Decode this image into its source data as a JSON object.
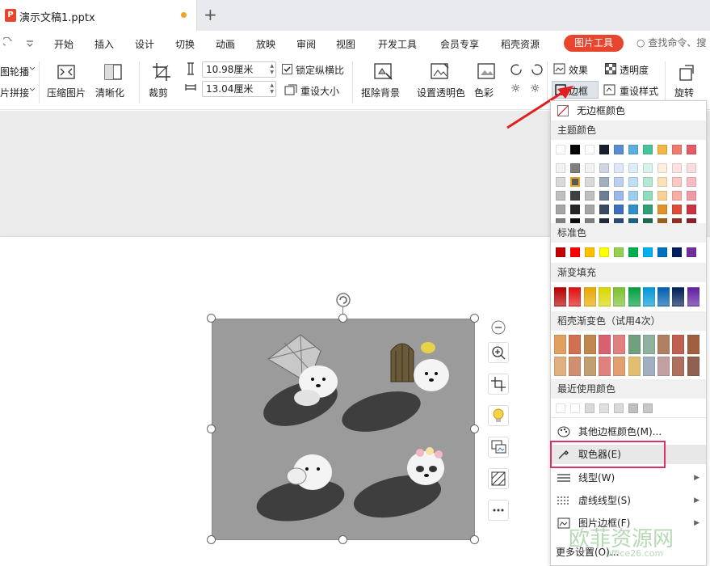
{
  "doc_tab": {
    "logo": "P",
    "title": "演示文稿1.pptx",
    "new_tab": "+"
  },
  "menu": {
    "items": [
      "开始",
      "插入",
      "设计",
      "切换",
      "动画",
      "放映",
      "审阅",
      "视图",
      "开发工具",
      "会员专享",
      "稻壳资源"
    ],
    "picture_tool": "图片工具",
    "search": "查找命令、搜"
  },
  "ribbon": {
    "carousel": "图轮播",
    "stitch": "片拼接",
    "compress": "压缩图片",
    "sharpen": "清晰化",
    "crop": "裁剪",
    "width": "10.98厘米",
    "height": "13.04厘米",
    "lock_ratio": "锁定纵横比",
    "lock_ratio_checked": true,
    "reset_size": "重设大小",
    "remove_bg": "抠除背景",
    "set_transparent": "设置透明色",
    "color": "色彩",
    "effects": "效果",
    "transparency": "透明度",
    "border": "边框",
    "reset_style": "重设样式",
    "rotate": "旋转"
  },
  "dropdown": {
    "no_border": "无边框颜色",
    "theme_title": "主题颜色",
    "theme_top": [
      "#ffffff",
      "#000000",
      "#ffffff",
      "#17202a",
      "#5b8bd0",
      "#5aaee0",
      "#48c39a",
      "#f2b54a",
      "#f07a6b",
      "#e65b68"
    ],
    "theme_shades": [
      [
        "#f2f2f2",
        "#7f7f7f",
        "#f2f2f2",
        "#d0d6e0",
        "#dde7f6",
        "#ddeef9",
        "#d9f3ea",
        "#fdf0db",
        "#fde4e1",
        "#fadde1"
      ],
      [
        "#d9d9d9",
        "#595959",
        "#d9d9d9",
        "#a3aebf",
        "#bdd0ee",
        "#bddff4",
        "#b5e7d5",
        "#fbe1b8",
        "#fac9c3",
        "#f5bcc3"
      ],
      [
        "#bfbfbf",
        "#404040",
        "#bfbfbf",
        "#6d7d95",
        "#9bb8e6",
        "#9ccfee",
        "#90dbc0",
        "#f8d294",
        "#f7ada4",
        "#f09aa5"
      ],
      [
        "#a6a6a6",
        "#262626",
        "#a6a6a6",
        "#3a4a60",
        "#3f6fb9",
        "#2f8fc8",
        "#2f9f77",
        "#e0932a",
        "#e04b39",
        "#cc3345"
      ],
      [
        "#7f7f7f",
        "#0d0d0d",
        "#7f7f7f",
        "#212c3a",
        "#2a4a7c",
        "#1f6086",
        "#1f6a4f",
        "#9a6219",
        "#952f22",
        "#88202e"
      ]
    ],
    "standard_title": "标准色",
    "standard": [
      "#c00000",
      "#ff0000",
      "#ffc000",
      "#ffff00",
      "#92d050",
      "#00b050",
      "#00b0f0",
      "#0070c0",
      "#002060",
      "#7030a0"
    ],
    "gradient_title": "渐变填充",
    "gradient": [
      "#b80000",
      "#e01010",
      "#e8a800",
      "#d8d800",
      "#7cc030",
      "#00a040",
      "#0098d8",
      "#0060b0",
      "#002058",
      "#6020a0"
    ],
    "docer_gradient_title": "稻壳渐变色（试用4次）",
    "docer_gradient_row1": [
      "#e0a060",
      "#d07050",
      "#c08850",
      "#d86070",
      "#e08080",
      "#70a080",
      "#90b0a0",
      "#b08060",
      "#c06050",
      "#a06040"
    ],
    "docer_gradient_row2": [
      "#e0b080",
      "#d09070",
      "#c0a070",
      "#e08080",
      "#e0a070",
      "#e0c070",
      "#a0b0c0",
      "#c0a0a0",
      "#b07060",
      "#906050"
    ],
    "recent_title": "最近使用颜色",
    "recent": [
      "#ffffff",
      "#ffffff",
      "#d9d9d9",
      "#e0e0e0",
      "#d9d9d9",
      "#c0c0c0",
      "#c8c8c8"
    ],
    "other_colors": "其他边框颜色(M)...",
    "eyedropper": "取色器(E)",
    "line_type": "线型(W)",
    "dash_type": "虚线线型(S)",
    "picture_border": "图片边框(F)",
    "more_settings": "更多设置(O)..."
  },
  "watermark": {
    "text": "欧菲资源网",
    "sub": "office26.com"
  }
}
